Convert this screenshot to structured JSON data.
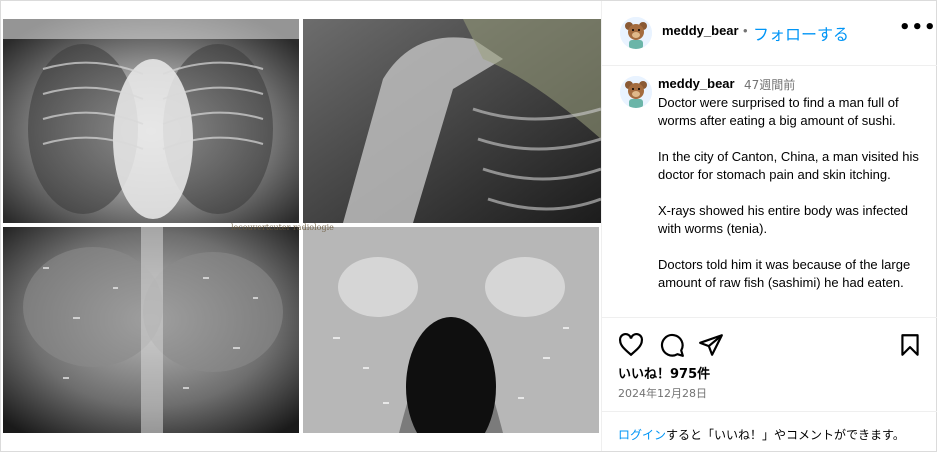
{
  "post": {
    "username": "meddy_bear",
    "follow_separator": "•",
    "follow_label": "フォローする",
    "more_label": "•••",
    "caption_time": "47週間前",
    "caption_text": "Doctor were surprised to find a man full of worms after eating a big amount of sushi.\n\nIn the city of Canton, China, a man visited his doctor for stomach pain and skin itching.\n\nX-rays showed his entire body was infected with worms (tenia).\n\nDoctors told him it was because of the large amount of raw fish (sashimi) he had eaten.",
    "likes": "いいね！975件",
    "date": "2024年12月28日",
    "login_link": "ログイン",
    "login_rest": "すると「いいね！」やコメントができます。"
  },
  "media": {
    "watermark": "lecouvertcuter radiologie"
  },
  "icons": {
    "heart": "heart-icon",
    "comment": "comment-icon",
    "share": "share-icon",
    "save": "bookmark-icon",
    "more": "more-icon"
  },
  "colors": {
    "accent": "#0095f6",
    "muted": "#737373",
    "divider": "#efefef"
  }
}
